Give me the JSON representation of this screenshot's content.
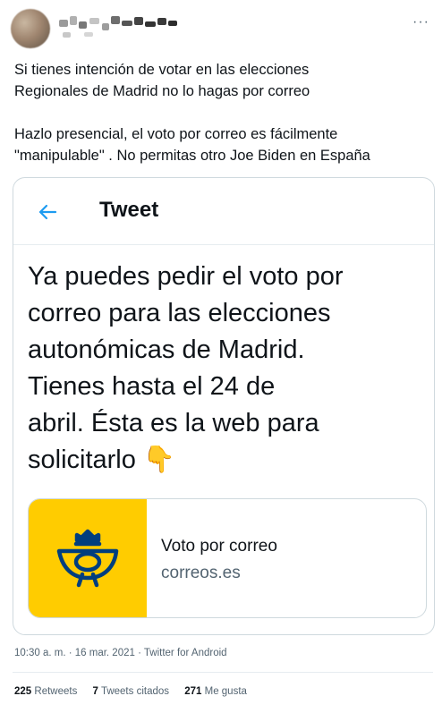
{
  "tweet": {
    "text_lines": [
      "Si tienes intención de votar en las elecciones",
      "Regionales de Madrid no lo hagas por correo",
      "Hazlo presencial, el voto por correo es fácilmente",
      "\"manipulable\" . No permitas otro Joe Biden en España"
    ],
    "more_label": "···"
  },
  "embed": {
    "header_title": "Tweet",
    "body_lines": [
      "Ya puedes pedir el voto por",
      "correo para las elecciones",
      "autonómicas de Madrid.",
      "Tienes hasta el 24 de",
      "abril. Ésta es la web para",
      "solicitarlo 👇"
    ],
    "card": {
      "title": "Voto por correo",
      "domain": "correos.es",
      "brand_color": "#ffcc00",
      "logo_color": "#003e7e",
      "logo_icon": "correos-logo-icon"
    },
    "accent_color": "#1d9bf0"
  },
  "meta": {
    "timestamp": "10:30 a. m. · 16 mar. 2021 · Twitter for Android"
  },
  "stats": {
    "retweets_count": "225",
    "retweets_label": "Retweets",
    "quotes_count": "7",
    "quotes_label": "Tweets citados",
    "likes_count": "271",
    "likes_label": "Me gusta"
  }
}
